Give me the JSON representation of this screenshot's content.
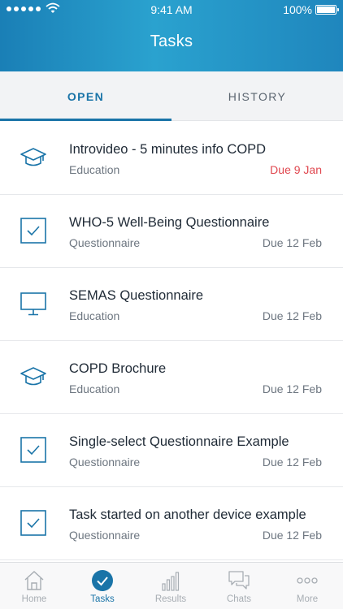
{
  "status_bar": {
    "time": "9:41 AM",
    "battery": "100%"
  },
  "header": {
    "title": "Tasks"
  },
  "tabs": [
    {
      "label": "OPEN",
      "active": true
    },
    {
      "label": "HISTORY",
      "active": false
    }
  ],
  "tasks": [
    {
      "title": "Introvideo - 5 minutes info COPD",
      "category": "Education",
      "due": "Due 9 Jan",
      "icon": "graduation-cap-icon",
      "overdue": true
    },
    {
      "title": "WHO-5 Well-Being Questionnaire",
      "category": "Questionnaire",
      "due": "Due 12 Feb",
      "icon": "checkbox-icon",
      "overdue": false
    },
    {
      "title": "SEMAS Questionnaire",
      "category": "Education",
      "due": "Due 12 Feb",
      "icon": "monitor-icon",
      "overdue": false
    },
    {
      "title": "COPD Brochure",
      "category": "Education",
      "due": "Due 12 Feb",
      "icon": "graduation-cap-icon",
      "overdue": false
    },
    {
      "title": "Single-select Questionnaire Example",
      "category": "Questionnaire",
      "due": "Due 12 Feb",
      "icon": "checkbox-icon",
      "overdue": false
    },
    {
      "title": "Task started on another device example",
      "category": "Questionnaire",
      "due": "Due 12 Feb",
      "icon": "checkbox-icon",
      "overdue": false
    }
  ],
  "tabbar": [
    {
      "label": "Home",
      "icon": "home-icon",
      "active": false
    },
    {
      "label": "Tasks",
      "icon": "check-circle-icon",
      "active": true
    },
    {
      "label": "Results",
      "icon": "bar-chart-icon",
      "active": false
    },
    {
      "label": "Chats",
      "icon": "chat-bubbles-icon",
      "active": false
    },
    {
      "label": "More",
      "icon": "more-dots-icon",
      "active": false
    }
  ],
  "colors": {
    "accent": "#1a74a8",
    "overdue": "#e0474f",
    "header_start": "#1a7fb6",
    "header_end": "#1f86bd"
  }
}
